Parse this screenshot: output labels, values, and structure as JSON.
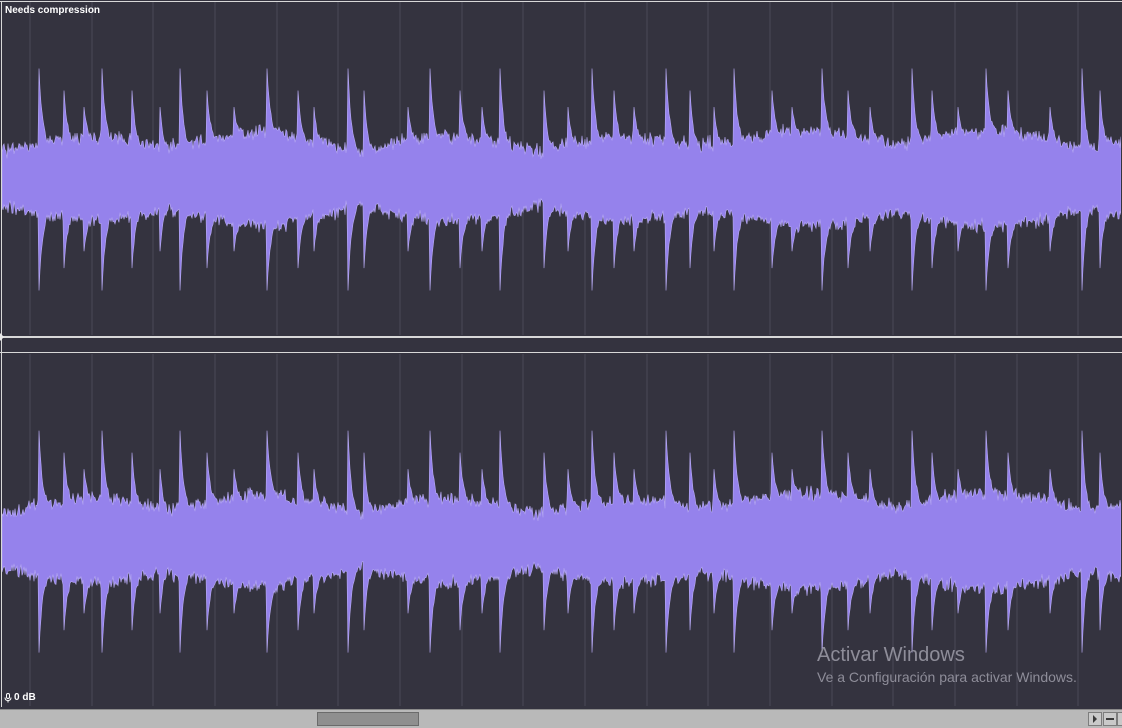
{
  "track": {
    "name": "Needs compression",
    "gain": "0 dB"
  },
  "waveform": {
    "color": "#9582ec",
    "background": "#34333f",
    "gridline_color": "#4a4957"
  },
  "watermark": {
    "title": "Activar Windows",
    "subtitle": "Ve a Configuración para activar Windows."
  },
  "icons": {
    "gain": "mic-icon",
    "scroll_right": "arrow-right-icon",
    "zoom_out": "minus-icon"
  }
}
